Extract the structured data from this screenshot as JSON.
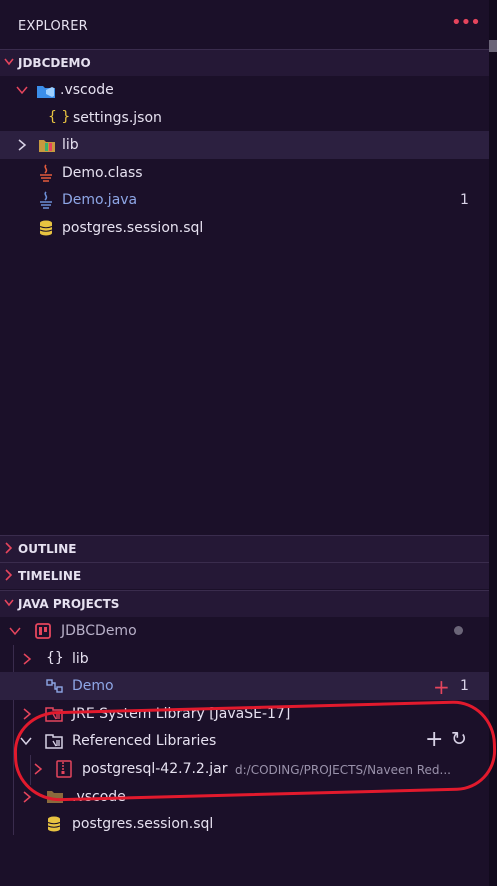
{
  "explorer": {
    "title": "EXPLORER",
    "more_icon": "ellipsis-icon",
    "workspace": "JDBCDEMO",
    "tree": [
      {
        "label": "vscode",
        "icon": "vscode-folder-icon"
      },
      {
        "label": "settings.json",
        "icon": "json-icon"
      },
      {
        "label": "lib",
        "icon": "library-folder-icon"
      },
      {
        "label": "Demo.class",
        "icon": "java-icon"
      },
      {
        "label": "Demo.java",
        "icon": "java-icon",
        "badge": "1"
      },
      {
        "label": "postgres.session.sql",
        "icon": "database-icon"
      }
    ]
  },
  "sections": {
    "outline": "OUTLINE",
    "timeline": "TIMELINE",
    "java_projects": "JAVA PROJECTS"
  },
  "java_projects": {
    "project": "JDBCDemo",
    "items": [
      {
        "label": "lib",
        "icon": "package-braces-icon"
      },
      {
        "label": "Demo",
        "icon": "class-icon",
        "badge": "1"
      },
      {
        "label": "JRE System Library [JavaSE-17]",
        "icon": "library-icon"
      },
      {
        "label": "Referenced Libraries",
        "icon": "library-icon"
      },
      {
        "label": "postgresql-42.7.2.jar",
        "path": "d:/CODING/PROJECTS/Naveen Red...",
        "icon": "jar-icon"
      },
      {
        "label": ".vscode",
        "icon": "folder-icon"
      },
      {
        "label": "postgres.session.sql",
        "icon": "database-icon"
      }
    ]
  },
  "colors": {
    "background": "#1b1029",
    "accent": "#e5455d",
    "annotation": "#e21a2d"
  }
}
